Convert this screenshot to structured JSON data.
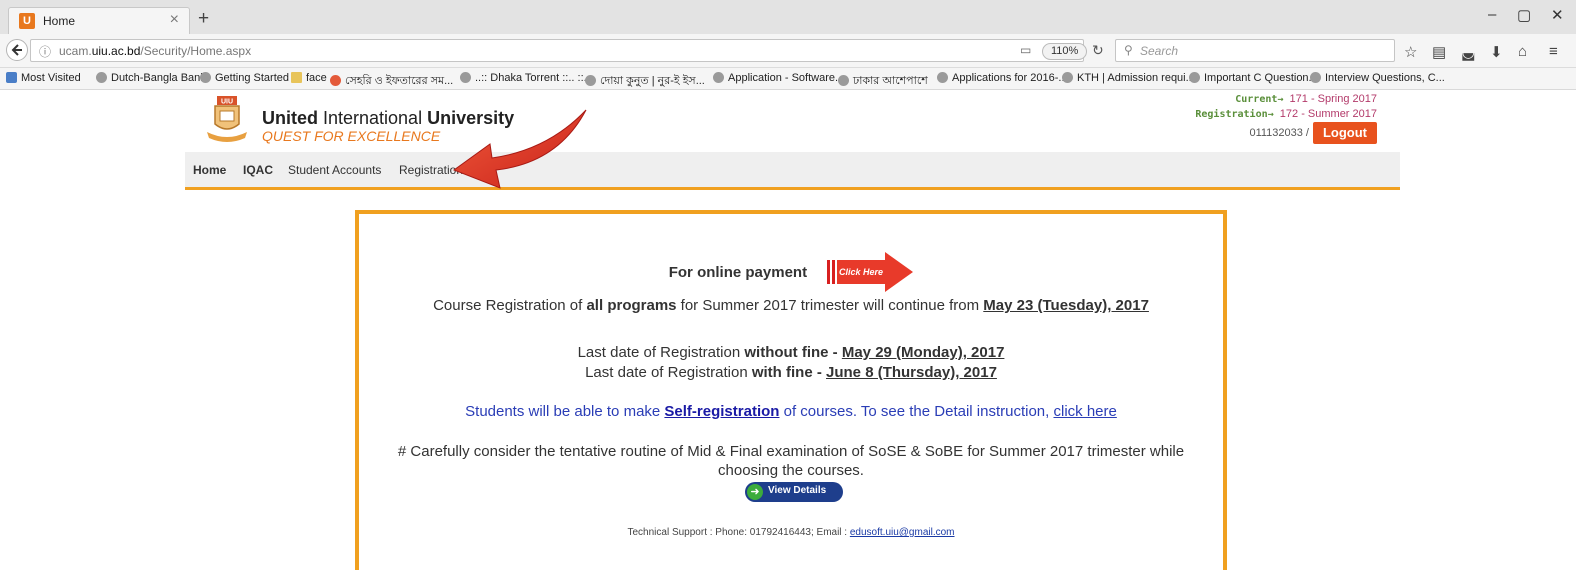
{
  "browser": {
    "tab_title": "Home",
    "tab_close": "×",
    "new_tab": "+",
    "url_domain": "ucam.uiu.ac.bd",
    "url_path": "/Security/Home.aspx",
    "url_prefix": "ucam.",
    "url_host_bold": "uiu.ac.bd",
    "zoom": "110%",
    "search_placeholder": "Search",
    "window_controls": [
      "–",
      "▢",
      "✕"
    ]
  },
  "bookmarks": [
    {
      "label": "Most Visited",
      "icon": "special"
    },
    {
      "label": "Dutch-Bangla Bank",
      "icon": "globe"
    },
    {
      "label": "Getting Started",
      "icon": "globe"
    },
    {
      "label": "face",
      "icon": "folder"
    },
    {
      "label": "সেহরি ও ইফতারের সম...",
      "icon": "red"
    },
    {
      "label": "..:: Dhaka Torrent ::.. ::...",
      "icon": "globe"
    },
    {
      "label": "দোয়া কুনুত | নুর-ই ইস...",
      "icon": "globe"
    },
    {
      "label": "Application - Software...",
      "icon": "globe"
    },
    {
      "label": "ঢাকার আশেপাশে",
      "icon": "globe"
    },
    {
      "label": "Applications for 2016-...",
      "icon": "globe"
    },
    {
      "label": "KTH | Admission requi...",
      "icon": "globe"
    },
    {
      "label": "Important C Question...",
      "icon": "globe"
    },
    {
      "label": "Interview Questions, C...",
      "icon": "globe"
    }
  ],
  "header": {
    "logo_text": "UIU",
    "university_bold": "United",
    "university_rest": " International ",
    "university_bold2": "University",
    "tagline": "QUEST FOR EXCELLENCE",
    "current_label": "Current→",
    "current_value": "171 - Spring 2017",
    "registration_label": "Registration→",
    "registration_value": "172 - Summer 2017",
    "user_id": "011132033 /",
    "logout": "Logout"
  },
  "menu": {
    "home": "Home",
    "iqac": "IQAC",
    "accounts": "Student Accounts",
    "registration": "Registration"
  },
  "notice": {
    "payment_label": "For online payment",
    "click_here_badge": "Click Here",
    "reg_pre": "Course Registration of ",
    "reg_bold": "all programs",
    "reg_mid": " for Summer 2017 trimester will continue from ",
    "reg_date": "May 23 (Tuesday), 2017",
    "last_wo_pre": "Last date of Registration ",
    "last_wo_bold": "without fine - ",
    "last_wo_date": "May 29 (Monday), 2017",
    "last_w_pre": "Last date of Registration ",
    "last_w_bold": "with fine - ",
    "last_w_date": "June 8 (Thursday), 2017",
    "self_pre": "Students will be able to make ",
    "self_link": "Self-registration",
    "self_mid": " of courses. To see the Detail instruction, ",
    "self_click": "click here",
    "routine_1": "# Carefully consider the tentative routine of Mid & Final examination of SoSE & SoBE for Summer 2017 trimester while",
    "routine_2": "choosing the courses.",
    "view_details": "View Details",
    "support_pre": "Technical Support : Phone: 01792416443; Email : ",
    "support_email": "edusoft.uiu@gmail.com"
  },
  "colors": {
    "accent_orange": "#f0a020",
    "logout_orange": "#e8521e",
    "link_blue": "#2a3db6"
  }
}
